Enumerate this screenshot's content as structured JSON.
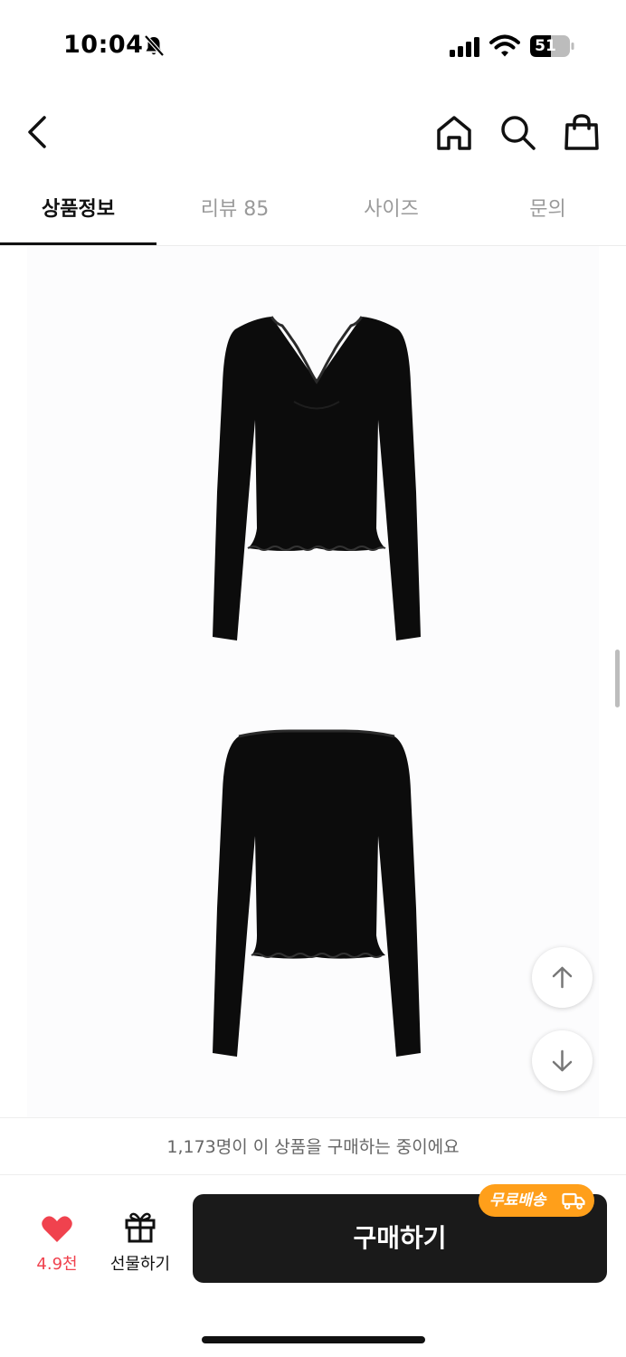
{
  "status_bar": {
    "time": "10:04",
    "battery": "51"
  },
  "nav": {
    "back_icon": "chevron-left-icon",
    "icons": [
      "home-icon",
      "search-icon",
      "shopping-bag-icon"
    ]
  },
  "tabs": [
    {
      "label": "상품정보",
      "active": true
    },
    {
      "label": "리뷰 85",
      "active": false
    },
    {
      "label": "사이즈",
      "active": false
    },
    {
      "label": "문의",
      "active": false
    }
  ],
  "content": {
    "images": [
      "product-front-black-lace-top",
      "product-back-black-lace-top"
    ],
    "scroll_buttons": [
      "arrow-up-icon",
      "arrow-down-icon"
    ]
  },
  "notice": {
    "text": "1,173명이 이 상품을 구매하는 중이에요"
  },
  "actions": {
    "like_count": "4.9천",
    "gift_label": "선물하기",
    "buy_label": "구매하기",
    "shipping_badge": "무료배송"
  },
  "colors": {
    "accent_red": "#f0424e",
    "badge_orange": "#ff9f1a",
    "button_dark": "#1a1a1a"
  }
}
